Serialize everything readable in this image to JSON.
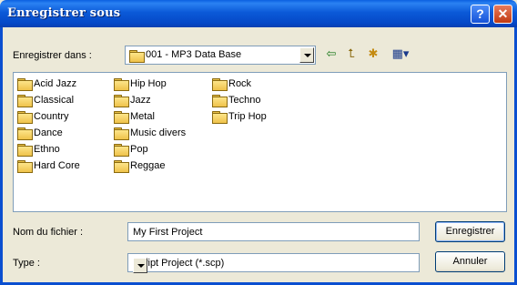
{
  "window": {
    "title": "Enregistrer sous",
    "help_label": "?",
    "close_label": "✕"
  },
  "location": {
    "label": "Enregistrer dans :",
    "value": "001 - MP3 Data Base"
  },
  "toolbar": {
    "back_icon": "⇦",
    "up_icon": "⮤",
    "new_folder_icon": "✱",
    "view_icon": "▦▾"
  },
  "folders": [
    "Acid Jazz",
    "Classical",
    "Country",
    "Dance",
    "Ethno",
    "Hard Core",
    "Hip Hop",
    "Jazz",
    "Metal",
    "Music divers",
    "Pop",
    "Reggae",
    "Rock",
    "Techno",
    "Trip Hop"
  ],
  "filename": {
    "label": "Nom du fichier :",
    "value": "My First Project"
  },
  "filetype": {
    "label": "Type :",
    "value": "Script Project (*.scp)"
  },
  "buttons": {
    "save": "Enregistrer",
    "cancel": "Annuler"
  }
}
